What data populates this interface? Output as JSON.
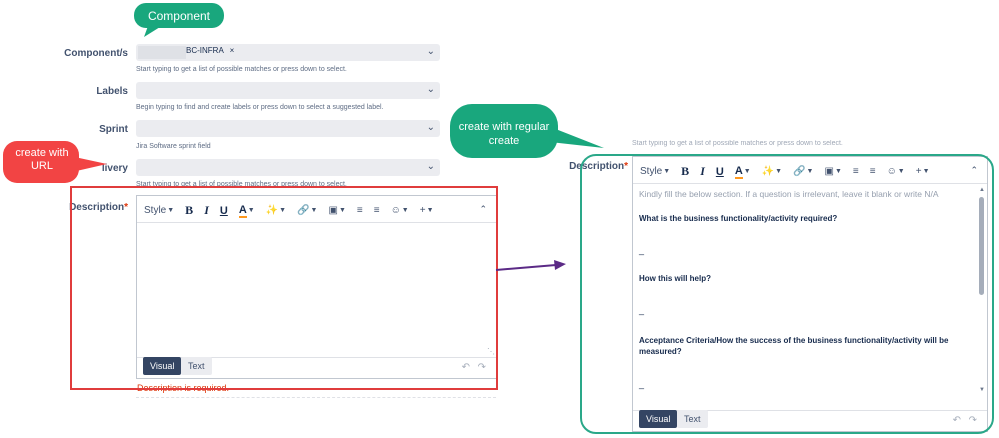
{
  "callouts": {
    "component": "Component",
    "url": "create with URL",
    "regular": "create with regular create"
  },
  "left_form": {
    "component_label": "Component/s",
    "component_value": "BC-INFRA",
    "component_remove": "×",
    "component_help": "Start typing to get a list of possible matches or press down to select.",
    "labels_label": "Labels",
    "labels_help": "Begin typing to find and create labels or press down to select a suggested label.",
    "sprint_label": "Sprint",
    "sprint_help": "Jira Software sprint field",
    "delivery_label": "livery",
    "delivery_help": "Start typing to get a list of possible matches or press down to select.",
    "description_label": "Description",
    "required_mark": "*",
    "description_error": "Description is required."
  },
  "toolbar": {
    "style": "Style",
    "bold": "B",
    "italic": "I",
    "underline": "U",
    "text_color": "A"
  },
  "tabs": {
    "visual": "Visual",
    "text": "Text"
  },
  "right_form": {
    "top_help": "Start typing to get a list of possible matches or press down to select.",
    "description_label": "Description",
    "required_mark": "*",
    "placeholder": "Kindly fill the below section. If a question is irrelevant, leave it blank or write N/A",
    "q1": "What is the business functionality/activity required?",
    "q2": "How this will help?",
    "q3": "Acceptance Criteria/How the success of the business functionality/activity will be measured?",
    "dash": "_"
  },
  "colors": {
    "callout_green": "#19a77d",
    "callout_red": "#f24444",
    "highlight_red": "#e03c3c",
    "highlight_teal": "#2aa889",
    "arrow_purple": "#5b2a86",
    "tab_dark": "#344563"
  }
}
